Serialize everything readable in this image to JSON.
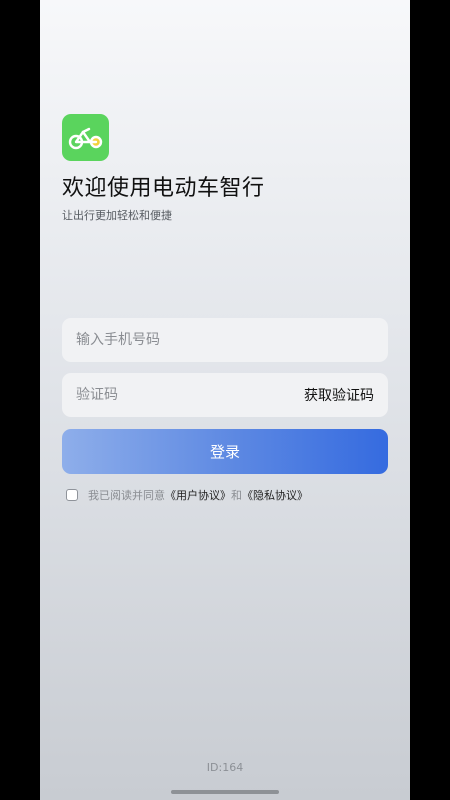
{
  "app": {
    "title": "欢迎使用电动车智行",
    "subtitle": "让出行更加轻松和便捷",
    "logo_icon": "bike-icon",
    "brand_color": "#5ad45d"
  },
  "form": {
    "phone_placeholder": "输入手机号码",
    "code_placeholder": "验证码",
    "get_code_label": "获取验证码",
    "login_label": "登录",
    "login_button_color": "#5b87e2"
  },
  "agreement": {
    "prefix": "我已阅读并同意",
    "user_agreement": "《用户协议》",
    "and": "和",
    "privacy_agreement": "《隐私协议》",
    "checked": false
  },
  "footer": {
    "id_text": "ID:164"
  }
}
